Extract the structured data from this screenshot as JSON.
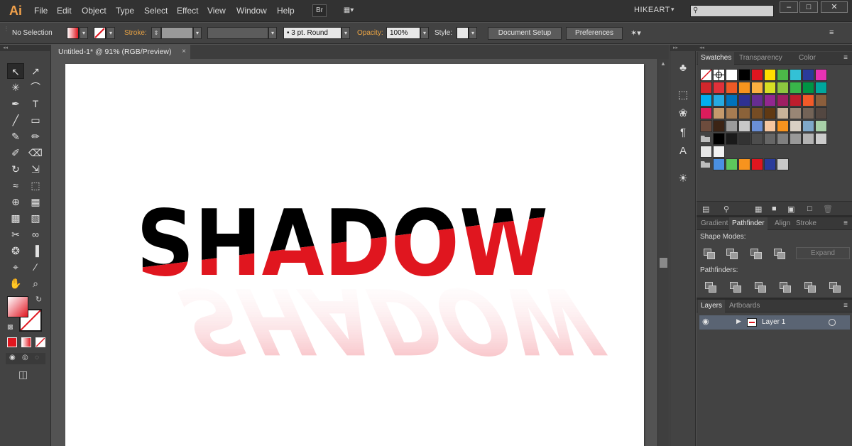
{
  "app": {
    "logo": "Ai",
    "workspace": "HIKEART",
    "bridge_label": "Br"
  },
  "menu": [
    "File",
    "Edit",
    "Object",
    "Type",
    "Select",
    "Effect",
    "View",
    "Window",
    "Help"
  ],
  "window_controls": [
    "–",
    "□",
    "✕"
  ],
  "control_bar": {
    "selection": "No Selection",
    "stroke_label": "Stroke:",
    "brush": "3 pt. Round",
    "opacity_label": "Opacity:",
    "opacity_value": "100%",
    "style_label": "Style:",
    "document_setup": "Document Setup",
    "preferences": "Preferences"
  },
  "document_tab": {
    "title": "Untitled-1* @ 91% (RGB/Preview)",
    "close": "×"
  },
  "artwork": {
    "text": "SHADOW",
    "colors": {
      "top": "#000000",
      "bottom": "#e0161f",
      "reflection": "#f28a94"
    }
  },
  "tools": [
    {
      "name": "selection-tool",
      "glyph": "↖"
    },
    {
      "name": "direct-selection-tool",
      "glyph": "↗"
    },
    {
      "name": "magic-wand-tool",
      "glyph": "✳"
    },
    {
      "name": "lasso-tool",
      "glyph": "⌒"
    },
    {
      "name": "pen-tool",
      "glyph": "✒"
    },
    {
      "name": "type-tool",
      "glyph": "T"
    },
    {
      "name": "line-tool",
      "glyph": "╱"
    },
    {
      "name": "rectangle-tool",
      "glyph": "▭"
    },
    {
      "name": "paintbrush-tool",
      "glyph": "✎"
    },
    {
      "name": "pencil-tool",
      "glyph": "✏"
    },
    {
      "name": "blob-brush-tool",
      "glyph": "✐"
    },
    {
      "name": "eraser-tool",
      "glyph": "⌫"
    },
    {
      "name": "rotate-tool",
      "glyph": "↻"
    },
    {
      "name": "scale-tool",
      "glyph": "⇲"
    },
    {
      "name": "width-tool",
      "glyph": "≈"
    },
    {
      "name": "free-transform-tool",
      "glyph": "⬚"
    },
    {
      "name": "shape-builder-tool",
      "glyph": "⊕"
    },
    {
      "name": "perspective-grid-tool",
      "glyph": "▦"
    },
    {
      "name": "mesh-tool",
      "glyph": "▩"
    },
    {
      "name": "gradient-tool",
      "glyph": "▧"
    },
    {
      "name": "eyedropper-tool",
      "glyph": "✂"
    },
    {
      "name": "blend-tool",
      "glyph": "∞"
    },
    {
      "name": "symbol-sprayer-tool",
      "glyph": "❂"
    },
    {
      "name": "column-graph-tool",
      "glyph": "▐"
    },
    {
      "name": "artboard-tool",
      "glyph": "⌖"
    },
    {
      "name": "slice-tool",
      "glyph": "∕"
    },
    {
      "name": "hand-tool",
      "glyph": "✋"
    },
    {
      "name": "zoom-tool",
      "glyph": "⌕"
    }
  ],
  "dock_icons": [
    {
      "name": "symbols-icon",
      "glyph": "♣"
    },
    {
      "name": "artboards-icon",
      "glyph": "⬚"
    },
    {
      "name": "brushes-icon",
      "glyph": "❀"
    },
    {
      "name": "paragraph-icon",
      "glyph": "¶"
    },
    {
      "name": "character-icon",
      "glyph": "A"
    },
    {
      "name": "appearance-icon",
      "glyph": "☀"
    }
  ],
  "swatches_panel": {
    "tabs": [
      "Swatches",
      "Transparency",
      "Color"
    ],
    "rows": [
      [
        "none",
        "reg",
        "#ffffff",
        "#000000",
        "#e0161f",
        "#ffdd00",
        "#4cb848",
        "#33c1d6",
        "#2a3b9a",
        "#e832b4"
      ],
      [
        "#d2272c",
        "#e0313a",
        "#ef5a26",
        "#f7941d",
        "#fbb040",
        "#d7df23",
        "#8dc63f",
        "#39b54a",
        "#009444",
        "#00a79d"
      ],
      [
        "#00aeef",
        "#27aae1",
        "#0072bc",
        "#2e3192",
        "#662d91",
        "#92278f",
        "#9e1f63",
        "#be1e2d",
        "#f15a29",
        "#8b5e3c"
      ],
      [
        "#da1c5c",
        "#c49a6c",
        "#a67c52",
        "#8b6239",
        "#754c24",
        "#603913",
        "#c7b299",
        "#998675",
        "#736357",
        "#534741"
      ],
      [
        "#6d4c3d",
        "#3c2415",
        "#9b9b9b",
        "#c8c8c8",
        "#6a8fd6",
        "#f5c6a0",
        "#f7931e",
        "#d9d0c4",
        "#7fa8c9",
        "#a8d0a8"
      ],
      [
        "folder",
        "#000000",
        "#1a1a1a",
        "#333333",
        "#4d4d4d",
        "#666666",
        "#808080",
        "#999999",
        "#b3b3b3",
        "#cccccc"
      ],
      [
        "#e6e6e6",
        "#f2f2f2"
      ],
      [
        "folder",
        "#4a90e2",
        "#5cc65c",
        "#f7931e",
        "#e0161f",
        "#2a3b9a",
        "#c8c8c8"
      ]
    ]
  },
  "pathfinder_panel": {
    "tabs": [
      "Gradient",
      "Pathfinder",
      "Align",
      "Stroke"
    ],
    "shape_modes_label": "Shape Modes:",
    "expand_label": "Expand",
    "pathfinders_label": "Pathfinders:"
  },
  "layers_panel": {
    "tabs": [
      "Layers",
      "Artboards"
    ],
    "layer_name": "Layer 1"
  }
}
